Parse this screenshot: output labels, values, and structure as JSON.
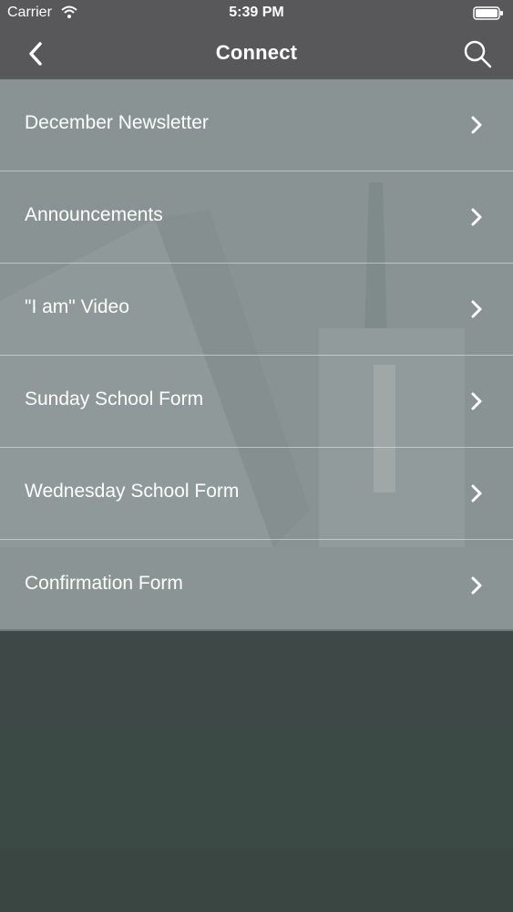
{
  "status_bar": {
    "carrier": "Carrier",
    "time": "5:39 PM",
    "icons": [
      "wifi-icon",
      "battery-icon"
    ]
  },
  "nav": {
    "title": "Connect",
    "back_icon": "chevron-left-icon",
    "search_icon": "search-icon"
  },
  "menu": {
    "items": [
      {
        "label": "December Newsletter"
      },
      {
        "label": "Announcements"
      },
      {
        "label": "\"I am\" Video"
      },
      {
        "label": "Sunday School Form"
      },
      {
        "label": "Wednesday School Form"
      },
      {
        "label": "Confirmation Form"
      }
    ],
    "chevron_icon": "chevron-right-icon"
  },
  "colors": {
    "bar_background": "#58585a",
    "text": "#ffffff"
  }
}
